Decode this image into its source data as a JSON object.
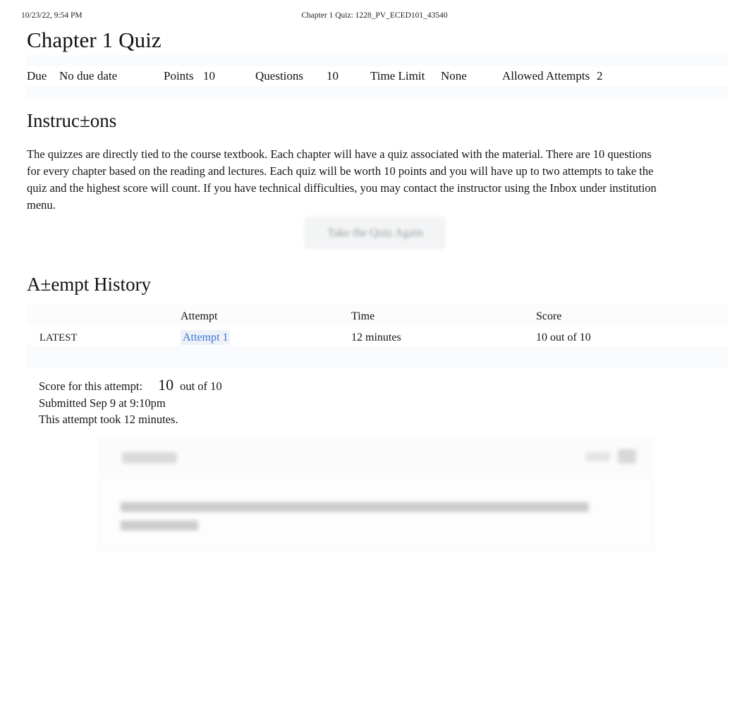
{
  "print_header": {
    "date": "10/23/22, 9:54 PM",
    "doc_title": "Chapter 1 Quiz: 1228_PV_ECED101_43540"
  },
  "page": {
    "title": "Chapter 1 Quiz"
  },
  "meta": {
    "due_label": "Due",
    "due_value": "No due date",
    "points_label": "Points",
    "points_value": "10",
    "questions_label": "Questions",
    "questions_value": "10",
    "time_limit_label": "Time Limit",
    "time_limit_value": "None",
    "allowed_attempts_label": "Allowed Attempts",
    "allowed_attempts_value": "2"
  },
  "instructions": {
    "heading": "Instruc±ons",
    "body": "The quizzes are directly tied to the course textbook. Each chapter will have a quiz associated with the material. There are 10 questions for every chapter based on the reading and lectures. Each quiz will be worth 10 points and you will have up to two attempts to take the quiz and the highest score will count. If you have technical difficulties, you may contact the instructor using the Inbox under institution menu."
  },
  "actions": {
    "take_quiz_again": "Take the Quiz Again"
  },
  "attempt_history": {
    "heading": "A±empt History",
    "columns": {
      "flag": "",
      "attempt": "Attempt",
      "time": "Time",
      "score": "Score"
    },
    "rows": [
      {
        "flag": "LATEST",
        "attempt": "Attempt 1",
        "time": "12 minutes",
        "score": "10 out of 10"
      }
    ]
  },
  "attempt_summary": {
    "score_label": "Score for this attempt:",
    "score_value": "10",
    "score_outof": "out of 10",
    "submitted": "Submitted Sep 9 at 9:10pm",
    "duration": "This attempt took 12 minutes."
  },
  "colors": {
    "link": "#3b72d9",
    "link_highlight": "#eef2f8",
    "band": "#fafbfc",
    "text": "#141414"
  }
}
